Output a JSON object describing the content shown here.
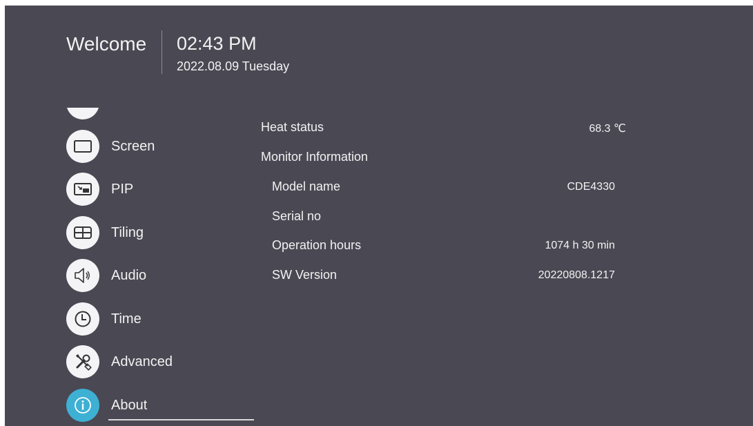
{
  "header": {
    "welcome": "Welcome",
    "time": "02:43 PM",
    "date": "2022.08.09 Tuesday"
  },
  "sidebar": {
    "items": [
      {
        "label": "",
        "icon": "partial-icon"
      },
      {
        "label": "Screen",
        "icon": "screen-icon"
      },
      {
        "label": "PIP",
        "icon": "pip-icon"
      },
      {
        "label": "Tiling",
        "icon": "tiling-icon"
      },
      {
        "label": "Audio",
        "icon": "audio-icon"
      },
      {
        "label": "Time",
        "icon": "clock-icon"
      },
      {
        "label": "Advanced",
        "icon": "tools-icon"
      },
      {
        "label": "About",
        "icon": "info-icon",
        "active": true
      }
    ]
  },
  "about": {
    "heat_label": "Heat status",
    "heat_value": "68.3 ℃",
    "monitor_info_label": "Monitor Information",
    "model_label": "Model name",
    "model_value": "CDE4330",
    "serial_label": "Serial no",
    "hours_label": "Operation hours",
    "hours_value": "1074 h 30 min",
    "sw_label": "SW Version",
    "sw_value": "20220808.1217"
  },
  "colors": {
    "background": "#4a4853",
    "accent": "#3db0d3",
    "icon_circle": "#f4f4f6"
  }
}
